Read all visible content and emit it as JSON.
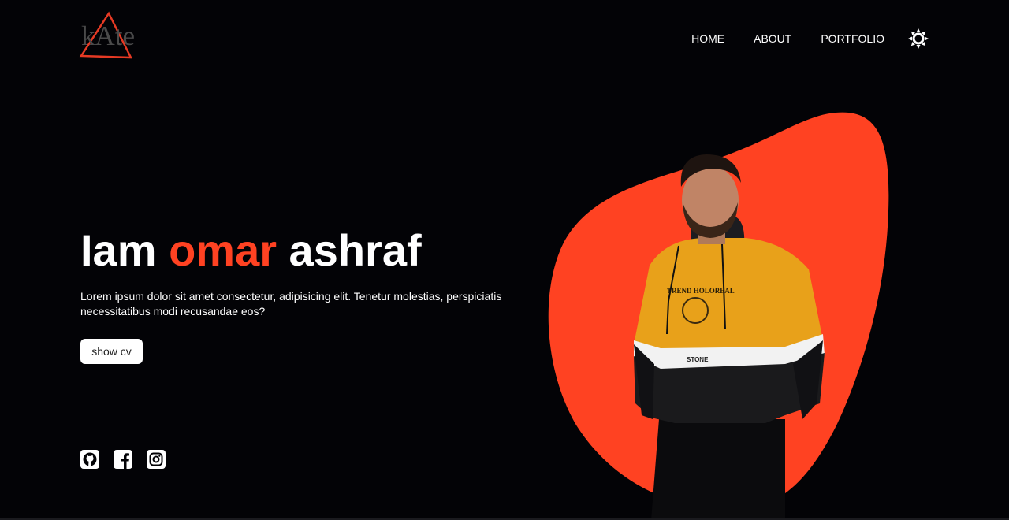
{
  "header": {
    "logo_text": "kAte",
    "nav": [
      {
        "label": "HOME"
      },
      {
        "label": "ABOUT"
      },
      {
        "label": "PORTFOLIO"
      }
    ],
    "theme_icon": "sun-icon"
  },
  "hero": {
    "title_part1": "Iam ",
    "title_accent": "omar",
    "title_part2": " ashraf",
    "description": "Lorem ipsum dolor sit amet consectetur, adipisicing elit. Tenetur molestias, perspiciatis necessitatibus modi recusandae eos?",
    "cv_button": "show cv",
    "shirt_text": "STONE",
    "shirt_print": "TREND HOLOREAL"
  },
  "socials": [
    {
      "icon": "github-icon"
    },
    {
      "icon": "facebook-icon"
    },
    {
      "icon": "instagram-icon"
    }
  ],
  "colors": {
    "background": "#030306",
    "accent": "#ff4222",
    "text": "#ffffff"
  }
}
